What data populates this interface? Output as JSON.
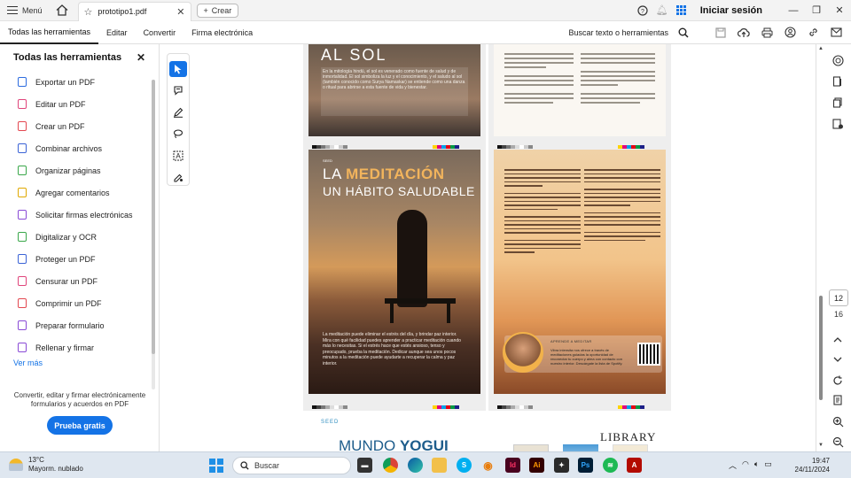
{
  "titlebar": {
    "menu_label": "Menú",
    "tab_title": "prototipo1.pdf",
    "create_label": "Crear",
    "signin_label": "Iniciar sesión"
  },
  "menubar": {
    "items": [
      "Todas las herramientas",
      "Editar",
      "Convertir",
      "Firma electrónica"
    ],
    "search_label": "Buscar texto o herramientas"
  },
  "leftpanel": {
    "title": "Todas las herramientas",
    "tools": [
      {
        "label": "Exportar un PDF",
        "color": "#2d6cdf",
        "icon": "export-pdf-icon"
      },
      {
        "label": "Editar un PDF",
        "color": "#e0457b",
        "icon": "edit-pdf-icon"
      },
      {
        "label": "Crear un PDF",
        "color": "#e34850",
        "icon": "create-pdf-icon"
      },
      {
        "label": "Combinar archivos",
        "color": "#3b63d6",
        "icon": "combine-files-icon"
      },
      {
        "label": "Organizar páginas",
        "color": "#3aa74a",
        "icon": "organize-pages-icon"
      },
      {
        "label": "Agregar comentarios",
        "color": "#e0a800",
        "icon": "comment-icon"
      },
      {
        "label": "Solicitar firmas electrónicas",
        "color": "#8a4bd6",
        "icon": "request-signature-icon"
      },
      {
        "label": "Digitalizar y OCR",
        "color": "#3aa74a",
        "icon": "scan-ocr-icon"
      },
      {
        "label": "Proteger un PDF",
        "color": "#3b63d6",
        "icon": "protect-pdf-icon"
      },
      {
        "label": "Censurar un PDF",
        "color": "#e0457b",
        "icon": "redact-pdf-icon"
      },
      {
        "label": "Comprimir un PDF",
        "color": "#e34850",
        "icon": "compress-pdf-icon"
      },
      {
        "label": "Preparar formulario",
        "color": "#8a4bd6",
        "icon": "prepare-form-icon"
      },
      {
        "label": "Rellenar y firmar",
        "color": "#8a4bd6",
        "icon": "fill-sign-icon"
      }
    ],
    "see_more": "Ver más",
    "description": "Convertir, editar y firmar electrónicamente formularios y acuerdos en PDF",
    "trial_button": "Prueba gratis"
  },
  "document": {
    "top_left_heading": "AL SOL",
    "top_left_text": "En la mitología hindú, el sol es venerado como fuente de salud y de inmortalidad. El sol simboliza la luz y el conocimiento, y el saludo al sol (también conocido como Surya Namaskar) se entiende como una danza o ritual para abrirse a esta fuente de vida y bienestar.",
    "meditation_tag": "SEED",
    "meditation_title_prefix": "LA ",
    "meditation_title_highlight": "MEDITACIÓN",
    "meditation_subtitle": "UN HÁBITO SALUDABLE",
    "meditation_body": "La meditación puede eliminar el estrés del día, y brindar paz interior. Mira con qué facilidad puedes aprender a practicar meditación cuando más lo necesitas. Si el estrés hace que estés ansioso, tenso y preocupado, prueba la meditación. Dedicar aunque sea unos pocos minutos a la meditación puede ayudarte a recuperar la calma y paz interior.",
    "promo_title": "APRENDE A MEDITAR",
    "promo_text": "Vibra intensita nos ofrece a través de meditaciones guiadas la oportunidad de reconectar tu cuerpo y alma con contacto con nuestro interior. Descárgate la lista de Spotify.",
    "bottom_left_tag": "SEED",
    "bottom_left_title_prefix": "MUNDO ",
    "bottom_left_title_highlight": "YOGUI",
    "bottom_right_title": "LIBRARY"
  },
  "pages": {
    "current": "12",
    "total": "16"
  },
  "taskbar": {
    "temperature": "13°C",
    "weather": "Mayorm. nublado",
    "search_placeholder": "Buscar",
    "time": "19:47",
    "date": "24/11/2024"
  }
}
